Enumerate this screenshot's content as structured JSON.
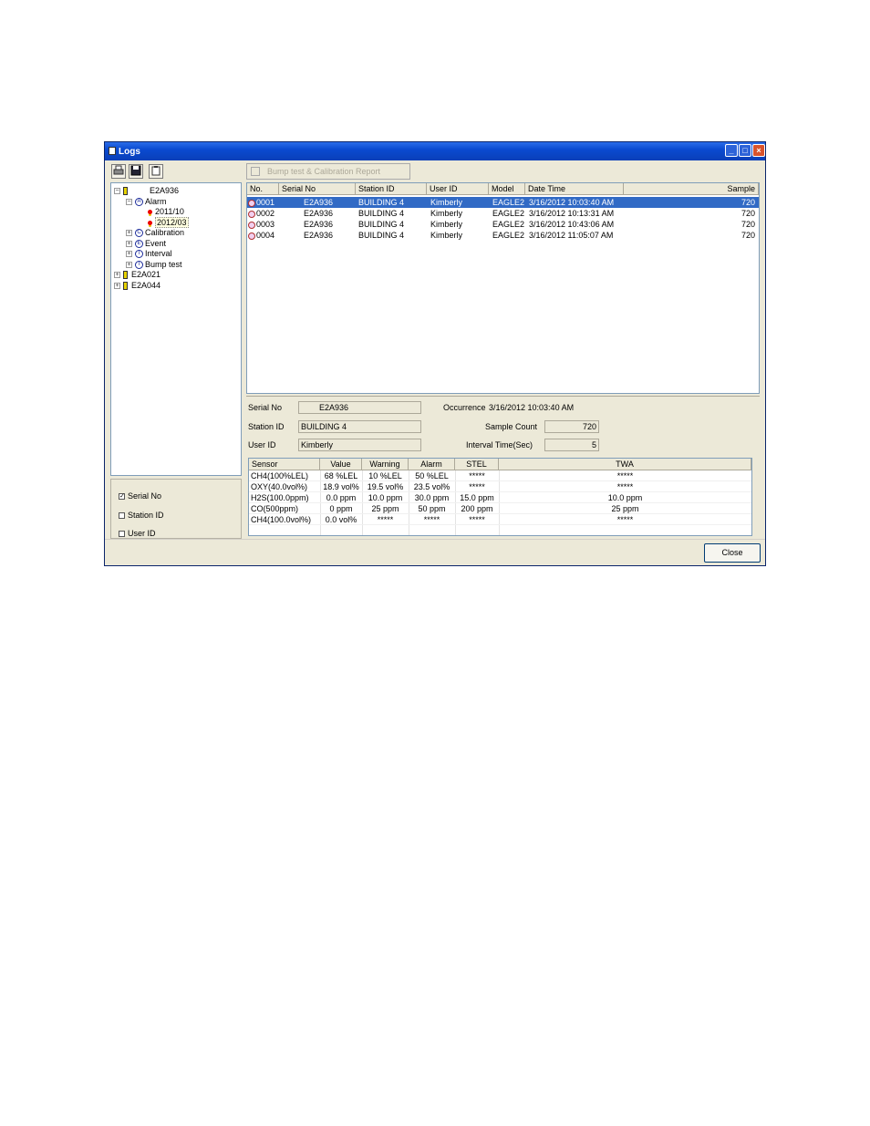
{
  "window": {
    "title": "Logs",
    "buttons": {
      "minimize": "_",
      "maximize": "□",
      "close": "×"
    }
  },
  "toolbar": {
    "report_label": "Bump test & Calibration Report"
  },
  "tree": {
    "devices": [
      {
        "name": "E2A936",
        "expanded": true
      },
      {
        "name": "E2A021",
        "expanded": false
      },
      {
        "name": "E2A044",
        "expanded": false
      }
    ],
    "categories": [
      {
        "letter": "A",
        "label": "Alarm"
      },
      {
        "letter": "C",
        "label": "Calibration"
      },
      {
        "letter": "E",
        "label": "Event"
      },
      {
        "letter": "I",
        "label": "Interval"
      },
      {
        "letter": "T",
        "label": "Bump test"
      }
    ],
    "alarm_months": [
      "2011/10",
      "2012/03"
    ]
  },
  "filters": [
    {
      "label": "Serial No",
      "checked": true
    },
    {
      "label": "Station ID",
      "checked": false
    },
    {
      "label": "User ID",
      "checked": false
    }
  ],
  "log_list": {
    "columns": [
      "No.",
      "Serial No",
      "Station ID",
      "User ID",
      "Model",
      "Date Time",
      "Sample"
    ],
    "rows": [
      {
        "no": "0001",
        "serial": "E2A936",
        "station": "BUILDING 4",
        "user": "Kimberly",
        "model": "EAGLE2",
        "datetime": "3/16/2012 10:03:40 AM",
        "sample": "720"
      },
      {
        "no": "0002",
        "serial": "E2A936",
        "station": "BUILDING 4",
        "user": "Kimberly",
        "model": "EAGLE2",
        "datetime": "3/16/2012 10:13:31 AM",
        "sample": "720"
      },
      {
        "no": "0003",
        "serial": "E2A936",
        "station": "BUILDING 4",
        "user": "Kimberly",
        "model": "EAGLE2",
        "datetime": "3/16/2012 10:43:06 AM",
        "sample": "720"
      },
      {
        "no": "0004",
        "serial": "E2A936",
        "station": "BUILDING 4",
        "user": "Kimberly",
        "model": "EAGLE2",
        "datetime": "3/16/2012 11:05:07 AM",
        "sample": "720"
      }
    ]
  },
  "details": {
    "serial_label": "Serial No",
    "serial_value": "E2A936",
    "station_label": "Station ID",
    "station_value": "BUILDING 4",
    "user_label": "User ID",
    "user_value": "Kimberly",
    "occurrence_label": "Occurrence",
    "occurrence_value": "3/16/2012 10:03:40 AM",
    "sample_count_label": "Sample Count",
    "sample_count_value": "720",
    "interval_label": "Interval Time(Sec)",
    "interval_value": "5"
  },
  "sensors": {
    "columns": [
      "Sensor",
      "Value",
      "Warning",
      "Alarm",
      "STEL",
      "TWA"
    ],
    "rows": [
      [
        "CH4(100%LEL)",
        "68 %LEL",
        "10 %LEL",
        "50 %LEL",
        "*****",
        "*****"
      ],
      [
        "OXY(40.0vol%)",
        "18.9 vol%",
        "19.5 vol%",
        "23.5 vol%",
        "*****",
        "*****"
      ],
      [
        "H2S(100.0ppm)",
        "0.0 ppm",
        "10.0 ppm",
        "30.0 ppm",
        "15.0 ppm",
        "10.0 ppm"
      ],
      [
        "CO(500ppm)",
        "0 ppm",
        "25 ppm",
        "50 ppm",
        "200 ppm",
        "25 ppm"
      ],
      [
        "CH4(100.0vol%)",
        "0.0 vol%",
        "*****",
        "*****",
        "*****",
        "*****"
      ]
    ]
  },
  "close_label": "Close"
}
